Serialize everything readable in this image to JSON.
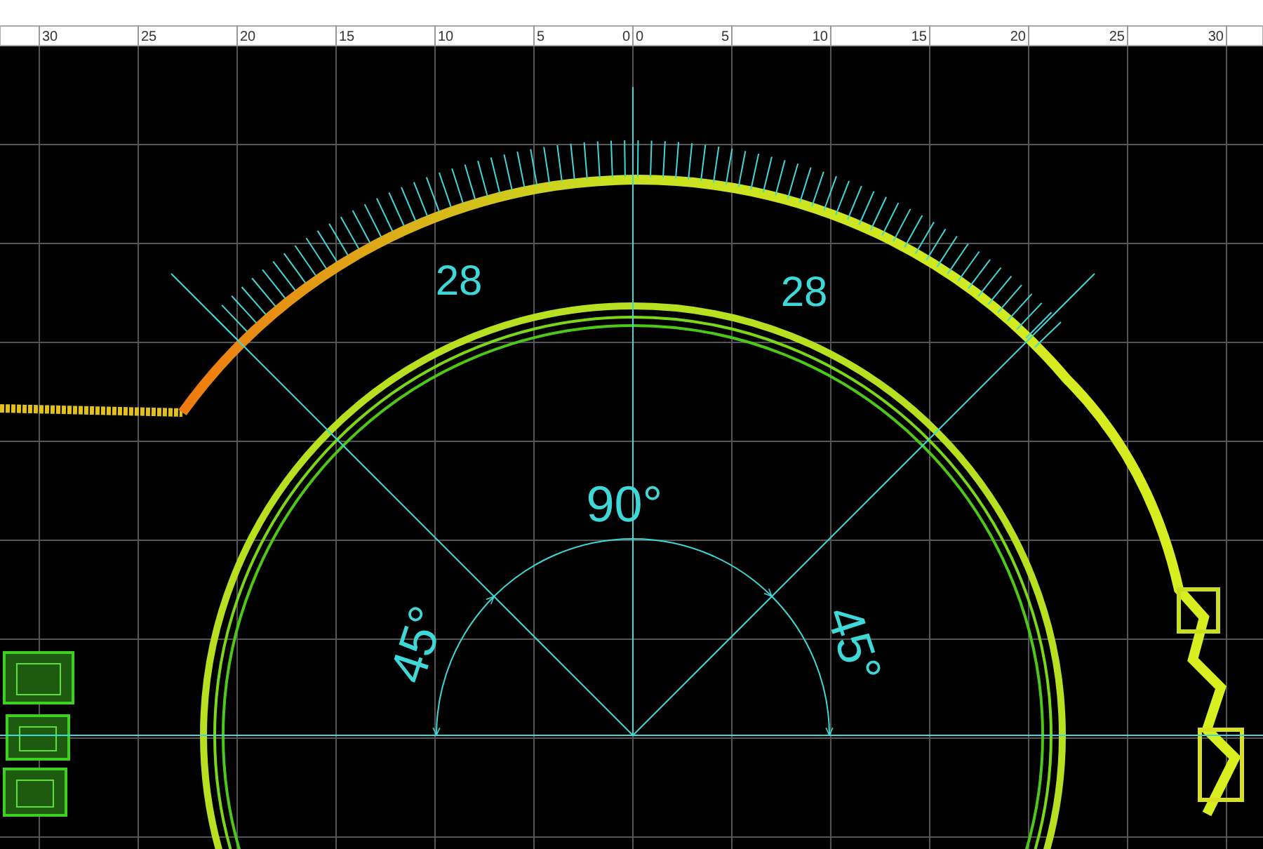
{
  "ruler": {
    "left_labels": [
      "30",
      "25",
      "20",
      "15",
      "10",
      "5",
      "0"
    ],
    "right_labels": [
      "0",
      "5",
      "10",
      "15",
      "20",
      "25",
      "30"
    ]
  },
  "annotations": [
    {
      "kind": "count",
      "text": "28"
    },
    {
      "kind": "count",
      "text": "28"
    },
    {
      "kind": "angle",
      "text": "90°"
    },
    {
      "kind": "angle_left",
      "text": "45°"
    },
    {
      "kind": "angle_right",
      "text": "45°"
    }
  ]
}
